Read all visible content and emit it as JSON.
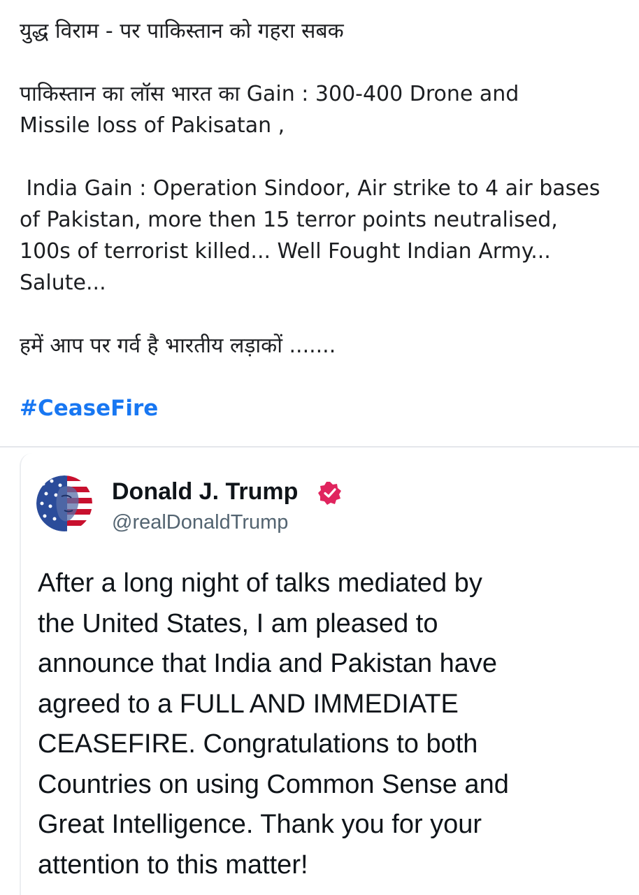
{
  "post": {
    "lines": [
      "युद्ध विराम  - पर पाकिस्तान को गहरा सबक",
      "पाकिस्तान का लॉस भारत का Gain   : 300-400 Drone and",
      "Missile loss of Pakisatan ,",
      " India Gain : Operation Sindoor, Air strike to 4 air bases",
      "of Pakistan, more then 15 terror points neutralised,",
      "100s of terrorist killed... Well Fought Indian Army...",
      "Salute...",
      "हमें आप पर गर्व है भारतीय लड़ाकों ......."
    ],
    "hashtag": "#CeaseFire"
  },
  "embed": {
    "author_name": "Donald J. Trump",
    "handle": "@realDonaldTrump",
    "verified_badge": "verified-badge-icon",
    "colors": {
      "badge": "#e0245e",
      "hashtag": "#1877f2",
      "handle": "#536471"
    },
    "text_lines": [
      "After a long night of talks mediated by",
      "the United States, I am pleased to",
      "announce that India and Pakistan have",
      "agreed to a FULL AND IMMEDIATE",
      "CEASEFIRE. Congratulations to both",
      "Countries on using Common Sense and",
      "Great Intelligence. Thank you for your",
      "attention to this matter!"
    ]
  }
}
